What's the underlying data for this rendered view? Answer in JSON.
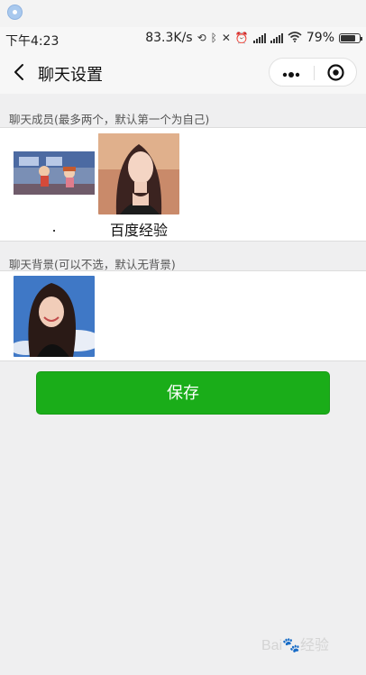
{
  "status_bar": {
    "time": "下午4:23",
    "speed": "83.3K/s",
    "battery_text": "79%",
    "battery_level": 0.79
  },
  "header": {
    "title": "聊天设置",
    "back_icon": "chevron-left-icon",
    "more_icon": "more-dots-icon",
    "close_icon": "target-circle-icon"
  },
  "members_section": {
    "label": "聊天成员(最多两个，默认第一个为自己)",
    "members": [
      {
        "name": "."
      },
      {
        "name": "百度经验"
      }
    ]
  },
  "background_section": {
    "label": "聊天背景(可以不选，默认无背景)"
  },
  "actions": {
    "save_label": "保存"
  },
  "colors": {
    "accent": "#1aad19",
    "page_bg": "#efeff0"
  }
}
